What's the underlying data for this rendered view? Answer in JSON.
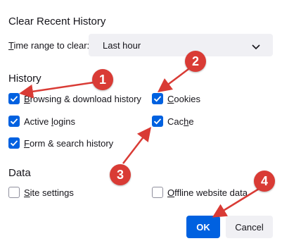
{
  "dialog": {
    "title": "Clear Recent History",
    "time_range_label_first": "T",
    "time_range_label_rest": "ime range to clear:",
    "time_range_value": "Last hour"
  },
  "history": {
    "heading": "History",
    "items": [
      {
        "label_first": "B",
        "label_rest": "rowsing & download history",
        "checked": true
      },
      {
        "label_first": "C",
        "label_rest": "ookies",
        "checked": true
      },
      {
        "label_first": "",
        "label_rest": "Active ",
        "label_ul": "l",
        "label_end": "ogins",
        "checked": true
      },
      {
        "label_first": "",
        "label_rest": "Cac",
        "label_ul": "h",
        "label_end": "e",
        "checked": true
      },
      {
        "label_first": "F",
        "label_rest": "orm & search history",
        "checked": true
      }
    ]
  },
  "data_section": {
    "heading": "Data",
    "items": [
      {
        "label_first": "S",
        "label_rest": "ite settings",
        "checked": false
      },
      {
        "label_first": "O",
        "label_rest": "ffline website data",
        "checked": false
      }
    ]
  },
  "buttons": {
    "ok": "OK",
    "cancel": "Cancel"
  },
  "annotations": [
    "1",
    "2",
    "3",
    "4"
  ],
  "colors": {
    "accent": "#0061e0",
    "annotation": "#d93b35",
    "button_neutral": "#f0f0f4"
  }
}
